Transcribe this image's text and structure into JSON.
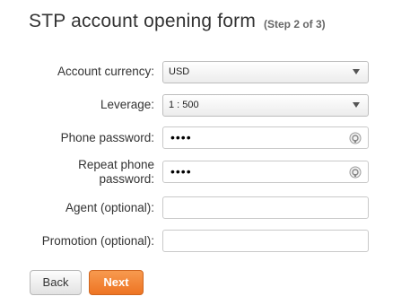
{
  "header": {
    "title": "STP account opening form",
    "step": "(Step 2 of 3)"
  },
  "form": {
    "account_currency": {
      "label": "Account currency:",
      "value": "USD"
    },
    "leverage": {
      "label": "Leverage:",
      "value": "1 : 500"
    },
    "phone_password": {
      "label": "Phone password:",
      "value": "••••",
      "icon": "eye-icon"
    },
    "repeat_phone_password": {
      "label_line1": "Repeat phone",
      "label_line2": "password:",
      "value": "••••",
      "icon": "eye-icon"
    },
    "agent": {
      "label": "Agent (optional):",
      "value": ""
    },
    "promotion": {
      "label": "Promotion (optional):",
      "value": ""
    }
  },
  "buttons": {
    "back": "Back",
    "next": "Next"
  },
  "colors": {
    "accent": "#ee7423",
    "text": "#333333"
  }
}
